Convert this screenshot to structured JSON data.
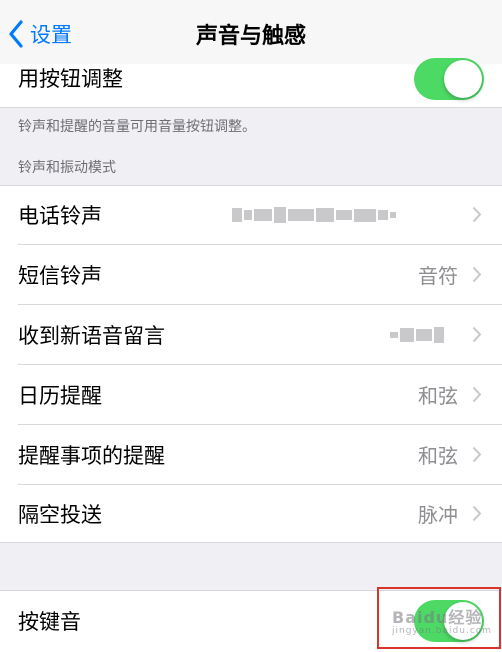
{
  "navbar": {
    "back_label": "设置",
    "title": "声音与触感"
  },
  "top_group": {
    "row_label": "用按钮调整",
    "toggle_on": true
  },
  "footnote": "铃声和提醒的音量可用音量按钮调整。",
  "section_header": "铃声和振动模式",
  "sounds": [
    {
      "label": "电话铃声",
      "value": ""
    },
    {
      "label": "短信铃声",
      "value": "音符"
    },
    {
      "label": "收到新语音留言",
      "value": ""
    },
    {
      "label": "日历提醒",
      "value": "和弦"
    },
    {
      "label": "提醒事项的提醒",
      "value": "和弦"
    },
    {
      "label": "隔空投送",
      "value": "脉冲"
    }
  ],
  "bottom_group": {
    "row_label": "按键音",
    "toggle_on": true
  },
  "watermark": {
    "text": "Baidu经验",
    "sub": "jingyan.baidu.com"
  },
  "colors": {
    "accent": "#007aff",
    "toggle_on": "#4cd964",
    "highlight_border": "#d9342b",
    "background": "#efeff4"
  }
}
